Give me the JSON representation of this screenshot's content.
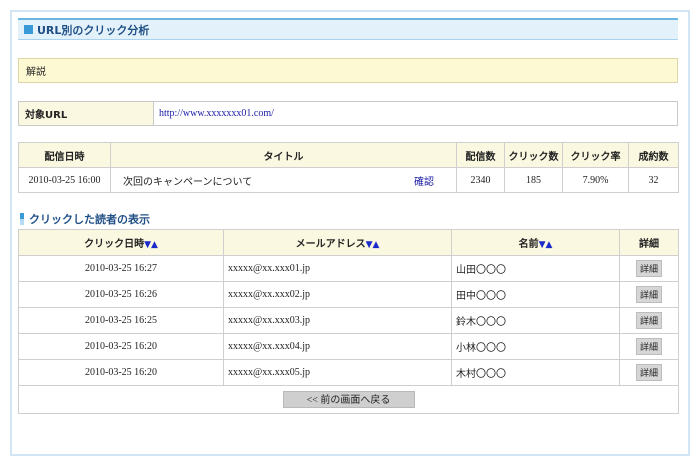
{
  "header": {
    "title": "URL別のクリック分析"
  },
  "note": {
    "label": "解説"
  },
  "target_url": {
    "label": "対象URL",
    "value": "http://www.xxxxxxx01.com/"
  },
  "summary": {
    "columns": [
      "配信日時",
      "タイトル",
      "配信数",
      "クリック数",
      "クリック率",
      "成約数"
    ],
    "row": {
      "date": "2010-03-25 16:00",
      "title": "次回のキャンペーンについて",
      "confirm_label": "確認",
      "sent": "2340",
      "clicks": "185",
      "click_rate": "7.90%",
      "conversions": "32"
    }
  },
  "readers": {
    "section_title": "クリックした読者の表示",
    "sort_icons": "▼▲",
    "columns": {
      "click_date": "クリック日時",
      "email": "メールアドレス",
      "name": "名前",
      "detail": "詳細"
    },
    "rows": [
      {
        "date": "2010-03-25 16:27",
        "email": "xxxxx@xx.xxx01.jp",
        "name": "山田〇〇〇",
        "detail": "詳細"
      },
      {
        "date": "2010-03-25 16:26",
        "email": "xxxxx@xx.xxx02.jp",
        "name": "田中〇〇〇",
        "detail": "詳細"
      },
      {
        "date": "2010-03-25 16:25",
        "email": "xxxxx@xx.xxx03.jp",
        "name": "鈴木〇〇〇",
        "detail": "詳細"
      },
      {
        "date": "2010-03-25 16:20",
        "email": "xxxxx@xx.xxx04.jp",
        "name": "小林〇〇〇",
        "detail": "詳細"
      },
      {
        "date": "2010-03-25 16:20",
        "email": "xxxxx@xx.xxx05.jp",
        "name": "木村〇〇〇",
        "detail": "詳細"
      }
    ],
    "back_label": "<< 前の画面へ戻る"
  }
}
